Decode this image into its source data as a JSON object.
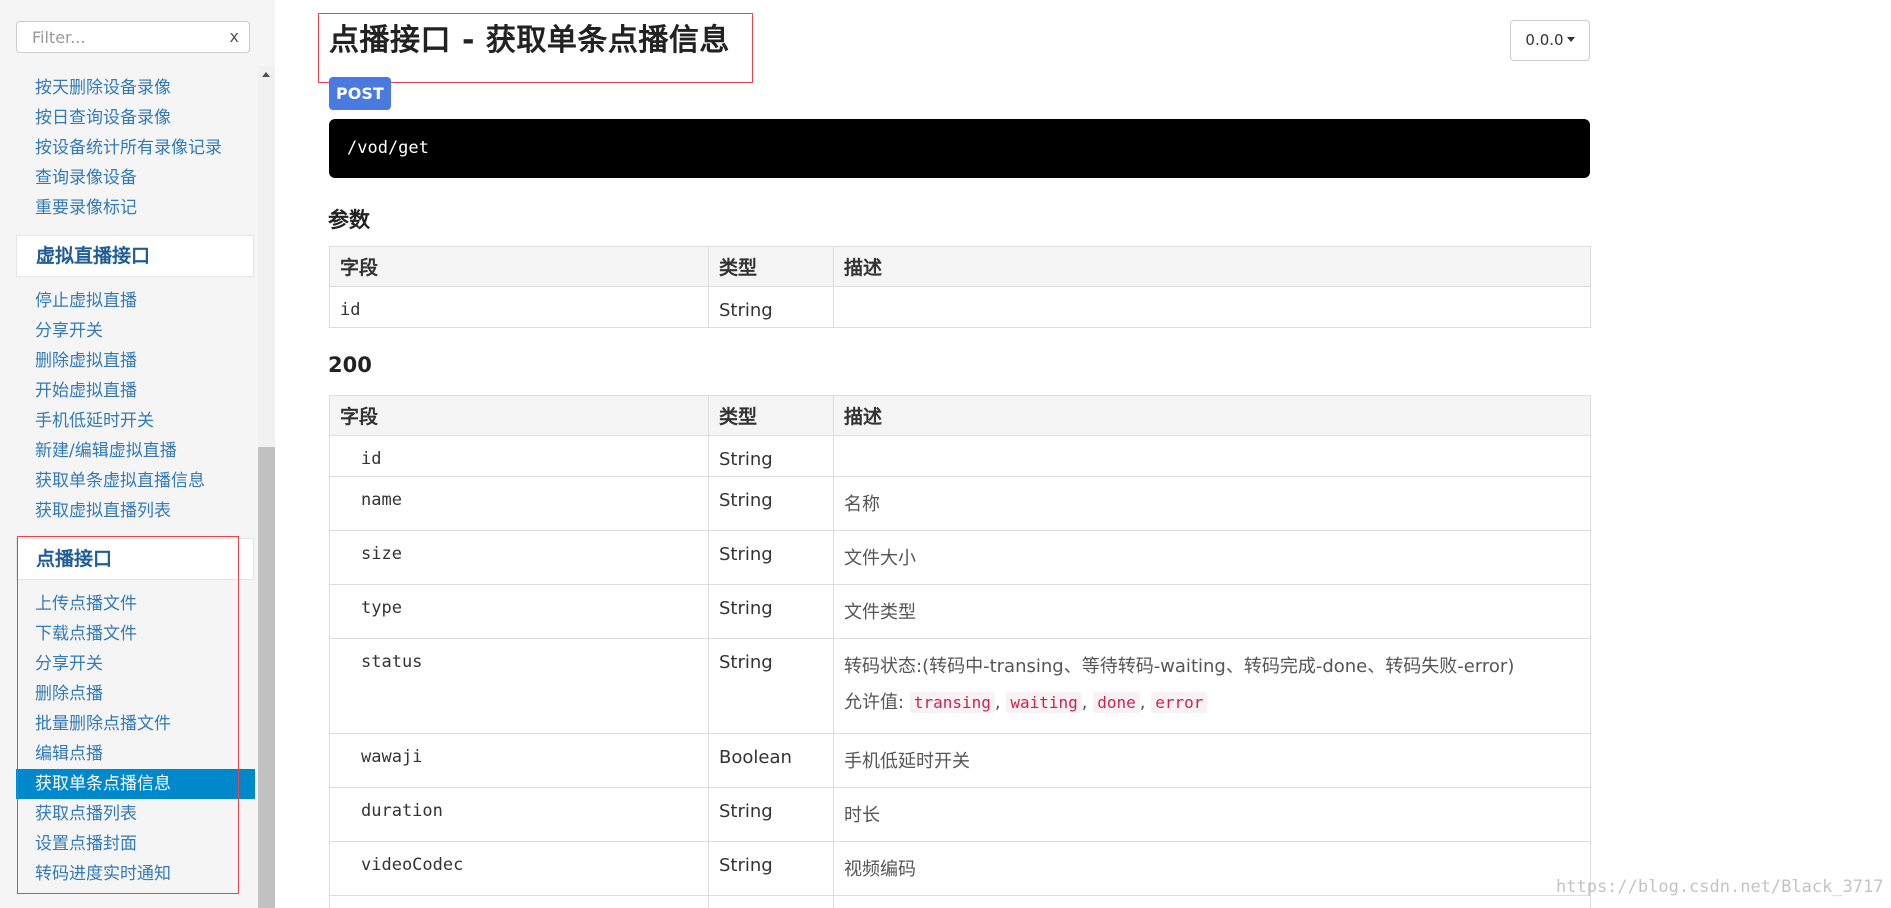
{
  "sidebar": {
    "filter_placeholder": "Filter...",
    "filter_clear": "x",
    "clipped_item": "",
    "items_top": [
      "按天删除设备录像",
      "按日查询设备录像",
      "按设备统计所有录像记录",
      "查询录像设备",
      "重要录像标记"
    ],
    "group_live": {
      "header": "虚拟直播接口",
      "items": [
        "停止虚拟直播",
        "分享开关",
        "删除虚拟直播",
        "开始虚拟直播",
        "手机低延时开关",
        "新建/编辑虚拟直播",
        "获取单条虚拟直播信息",
        "获取虚拟直播列表"
      ]
    },
    "group_vod": {
      "header": "点播接口",
      "items": [
        "上传点播文件",
        "下载点播文件",
        "分享开关",
        "删除点播",
        "批量删除点播文件",
        "编辑点播",
        "获取单条点播信息",
        "获取点播列表",
        "设置点播封面",
        "转码进度实时通知"
      ],
      "active_index": 6
    }
  },
  "main": {
    "title": "点播接口 - 获取单条点播信息",
    "version": "0.0.0",
    "method": "POST",
    "endpoint": "/vod/get",
    "params": {
      "title": "参数",
      "headers": [
        "字段",
        "类型",
        "描述"
      ],
      "rows": [
        {
          "field": "id",
          "type": "String",
          "desc": ""
        }
      ]
    },
    "response": {
      "title": "200",
      "headers": [
        "字段",
        "类型",
        "描述"
      ],
      "rows": [
        {
          "field": "id",
          "type": "String",
          "desc": ""
        },
        {
          "field": "name",
          "type": "String",
          "desc": "名称"
        },
        {
          "field": "size",
          "type": "String",
          "desc": "文件大小"
        },
        {
          "field": "type",
          "type": "String",
          "desc": "文件类型"
        },
        {
          "field": "status",
          "type": "String",
          "desc": "转码状态:(转码中-transing、等待转码-waiting、转码完成-done、转码失败-error)",
          "allowed_label": "允许值:",
          "allowed_values": [
            "transing",
            "waiting",
            "done",
            "error"
          ]
        },
        {
          "field": "wawaji",
          "type": "Boolean",
          "desc": "手机低延时开关"
        },
        {
          "field": "duration",
          "type": "String",
          "desc": "时长"
        },
        {
          "field": "videoCodec",
          "type": "String",
          "desc": "视频编码"
        }
      ]
    }
  },
  "watermark": "https://blog.csdn.net/Black_3717",
  "colors": {
    "link": "#337ab7",
    "active_bg": "#0088cc",
    "method_badge": "#4a7ae0",
    "annotation": "#e8434f",
    "code_text": "#c7254e"
  }
}
